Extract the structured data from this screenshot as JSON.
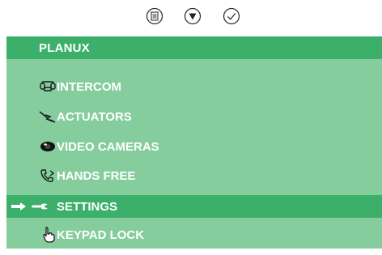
{
  "top_buttons": [
    {
      "name": "menu",
      "symbol": "menu-icon"
    },
    {
      "name": "down",
      "symbol": "down-triangle-icon"
    },
    {
      "name": "ok",
      "symbol": "check-icon"
    }
  ],
  "header": {
    "title": "PLANUX"
  },
  "menu": {
    "items": [
      {
        "label": "INTERCOM",
        "icon": "intercom-icon",
        "selected": false
      },
      {
        "label": "ACTUATORS",
        "icon": "actuator-icon",
        "selected": false
      },
      {
        "label": "VIDEO CAMERAS",
        "icon": "camera-icon",
        "selected": false
      },
      {
        "label": "HANDS FREE",
        "icon": "handsfree-icon",
        "selected": false
      },
      {
        "label": "SETTINGS",
        "icon": "settings-icon",
        "selected": true
      },
      {
        "label": "KEYPAD LOCK",
        "icon": "hand-pointer-icon",
        "selected": false
      }
    ]
  },
  "colors": {
    "panel_bg": "#86cd9e",
    "highlight": "#3cb06a",
    "text": "#ffffff"
  }
}
